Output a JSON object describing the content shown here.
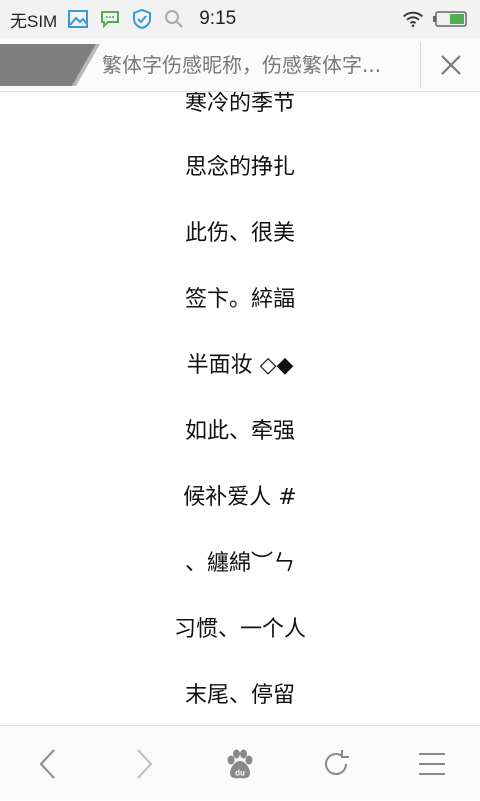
{
  "status_bar": {
    "sim_text": "无SIM",
    "time": "9:15",
    "icons": [
      "image-icon",
      "message-icon",
      "shield-icon",
      "search-icon",
      "wifi-icon",
      "battery-icon"
    ]
  },
  "title_bar": {
    "title": "繁体字伤感昵称，伤感繁体字..."
  },
  "content": {
    "items": [
      "寒冷的季节",
      "思念的挣扎",
      "此伤、很美",
      "签卞。綷諨",
      "半面妆 ◇◆",
      "如此、牵强",
      "候补爱人 #",
      "、纏綿︶ㄣ",
      "习惯、一个人",
      "末尾、停留"
    ]
  },
  "bottom_nav": {
    "buttons": [
      "back-icon",
      "forward-icon",
      "baidu-paw-icon",
      "refresh-icon",
      "menu-icon"
    ]
  },
  "colors": {
    "accent_blue": "#3a9ad9",
    "accent_green": "#4caf50",
    "icon_gray": "#888888"
  }
}
